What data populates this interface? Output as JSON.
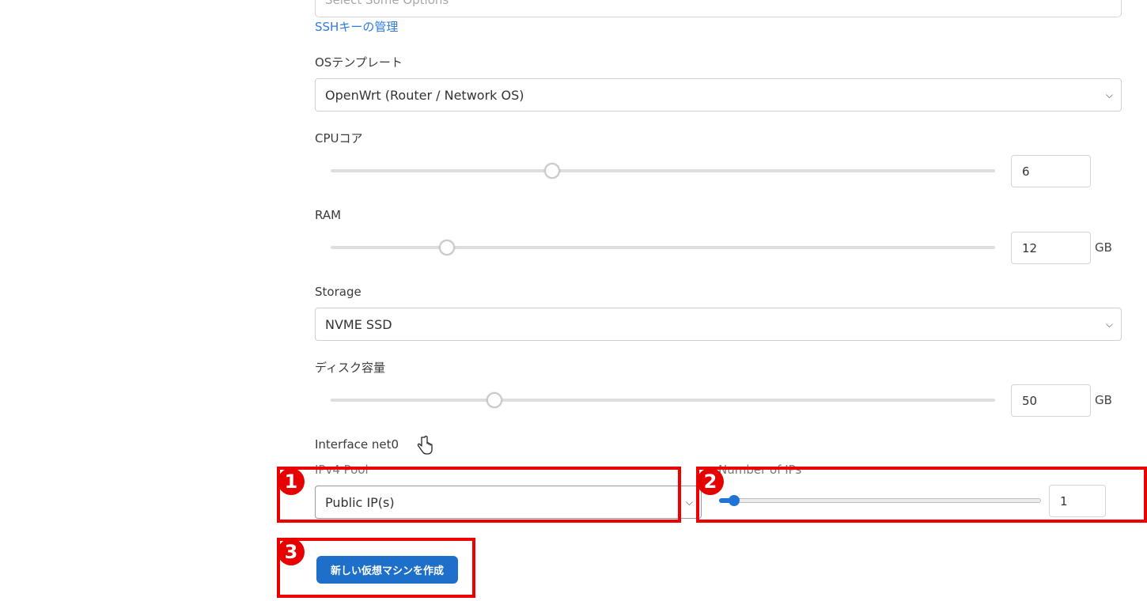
{
  "ssh": {
    "placeholder": "Select Some Options",
    "manage_link": "SSHキーの管理"
  },
  "os_template": {
    "label": "OSテンプレート",
    "selected": "OpenWrt (Router / Network OS)"
  },
  "cpu": {
    "label": "CPUコア",
    "value": "6",
    "slider_fraction": 0.33
  },
  "ram": {
    "label": "RAM",
    "value": "12",
    "unit": "GB",
    "slider_fraction": 0.175
  },
  "storage": {
    "label": "Storage",
    "selected": "NVME SSD"
  },
  "disk": {
    "label": "ディスク容量",
    "value": "50",
    "unit": "GB",
    "slider_fraction": 0.245
  },
  "interface": {
    "label": "Interface net0",
    "ipv4_pool_label": "IPv4 Pool",
    "ipv4_pool_selected": "Public IP(s)",
    "num_ips_label": "Number of IPs",
    "num_ips_value": "1",
    "num_ips_fraction": 0.0
  },
  "create_button": {
    "label": "新しい仮想マシンを作成"
  },
  "annotations": {
    "badge1": "1",
    "badge2": "2",
    "badge3": "3",
    "color": "#ee0000"
  },
  "colors": {
    "accent": "#1e6fc9",
    "link": "#2f7bd8"
  }
}
